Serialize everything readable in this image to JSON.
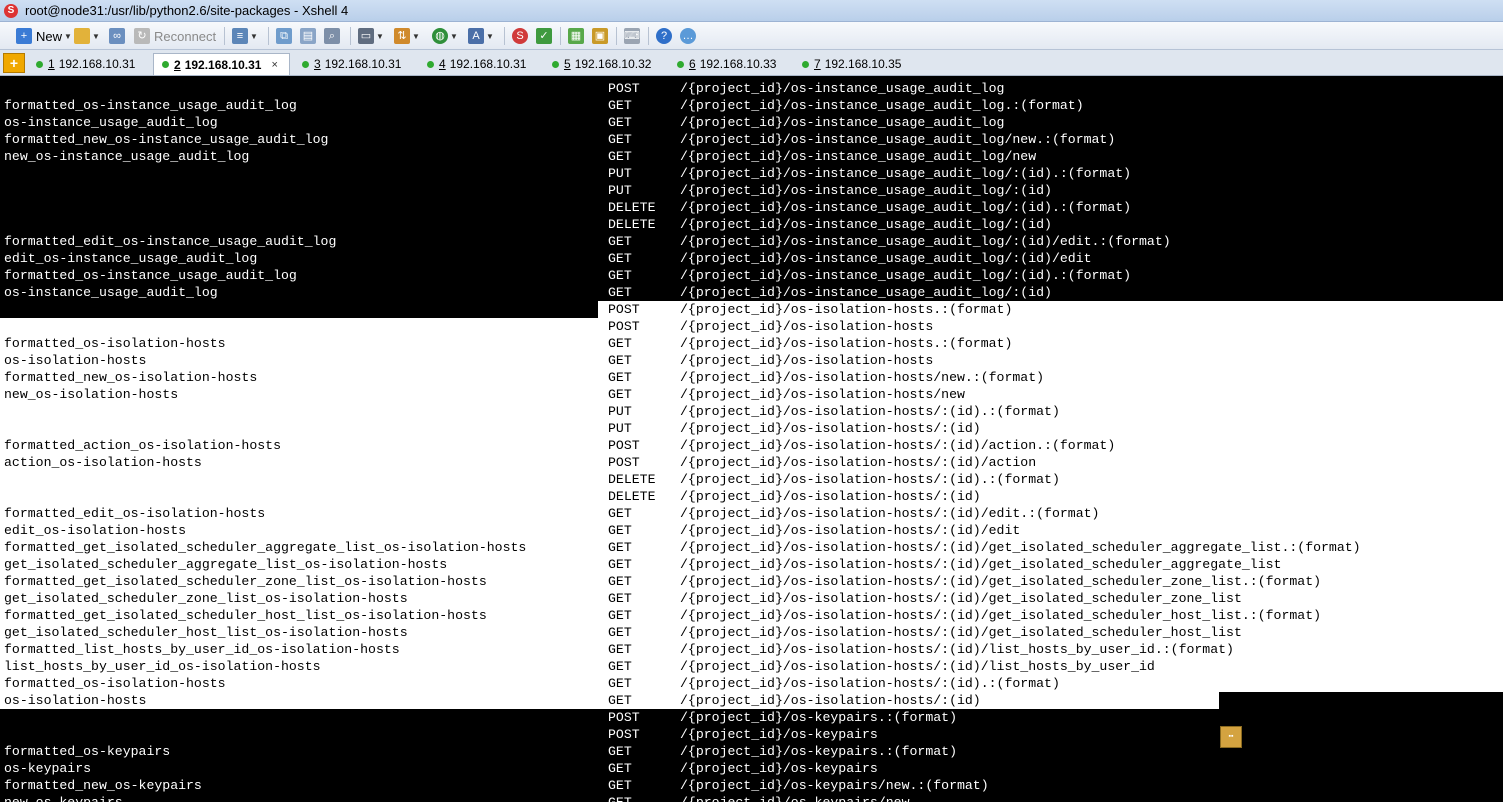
{
  "window": {
    "title": "root@node31:/usr/lib/python2.6/site-packages - Xshell 4"
  },
  "toolbar": {
    "new_label": "New",
    "reconnect_label": "Reconnect"
  },
  "tabs": [
    {
      "index": "1",
      "host": "192.168.10.31",
      "active": false
    },
    {
      "index": "2",
      "host": "192.168.10.31",
      "active": true
    },
    {
      "index": "3",
      "host": "192.168.10.31",
      "active": false
    },
    {
      "index": "4",
      "host": "192.168.10.31",
      "active": false
    },
    {
      "index": "5",
      "host": "192.168.10.32",
      "active": false
    },
    {
      "index": "6",
      "host": "192.168.10.33",
      "active": false
    },
    {
      "index": "7",
      "host": "192.168.10.35",
      "active": false
    }
  ],
  "tab_close_glyph": "×",
  "colors": {
    "terminal_bg": "#000000",
    "terminal_fg": "#ffffff",
    "selection_bg": "#ffffff",
    "selection_fg": "#000000",
    "connected_dot": "#2faa2f"
  },
  "terminal": {
    "lines": [
      {
        "name": "",
        "method": "POST",
        "path": "/{project_id}/os-instance_usage_audit_log"
      },
      {
        "name": "formatted_os-instance_usage_audit_log",
        "method": "GET",
        "path": "/{project_id}/os-instance_usage_audit_log.:(format)"
      },
      {
        "name": "os-instance_usage_audit_log",
        "method": "GET",
        "path": "/{project_id}/os-instance_usage_audit_log"
      },
      {
        "name": "formatted_new_os-instance_usage_audit_log",
        "method": "GET",
        "path": "/{project_id}/os-instance_usage_audit_log/new.:(format)"
      },
      {
        "name": "new_os-instance_usage_audit_log",
        "method": "GET",
        "path": "/{project_id}/os-instance_usage_audit_log/new"
      },
      {
        "name": "",
        "method": "PUT",
        "path": "/{project_id}/os-instance_usage_audit_log/:(id).:(format)"
      },
      {
        "name": "",
        "method": "PUT",
        "path": "/{project_id}/os-instance_usage_audit_log/:(id)"
      },
      {
        "name": "",
        "method": "DELETE",
        "path": "/{project_id}/os-instance_usage_audit_log/:(id).:(format)"
      },
      {
        "name": "",
        "method": "DELETE",
        "path": "/{project_id}/os-instance_usage_audit_log/:(id)"
      },
      {
        "name": "formatted_edit_os-instance_usage_audit_log",
        "method": "GET",
        "path": "/{project_id}/os-instance_usage_audit_log/:(id)/edit.:(format)"
      },
      {
        "name": "edit_os-instance_usage_audit_log",
        "method": "GET",
        "path": "/{project_id}/os-instance_usage_audit_log/:(id)/edit"
      },
      {
        "name": "formatted_os-instance_usage_audit_log",
        "method": "GET",
        "path": "/{project_id}/os-instance_usage_audit_log/:(id).:(format)"
      },
      {
        "name": "os-instance_usage_audit_log",
        "method": "GET",
        "path": "/{project_id}/os-instance_usage_audit_log/:(id)"
      },
      {
        "name": "",
        "method": "POST",
        "path": "/{project_id}/os-isolation-hosts.:(format)"
      },
      {
        "name": "",
        "method": "POST",
        "path": "/{project_id}/os-isolation-hosts"
      },
      {
        "name": "formatted_os-isolation-hosts",
        "method": "GET",
        "path": "/{project_id}/os-isolation-hosts.:(format)"
      },
      {
        "name": "os-isolation-hosts",
        "method": "GET",
        "path": "/{project_id}/os-isolation-hosts"
      },
      {
        "name": "formatted_new_os-isolation-hosts",
        "method": "GET",
        "path": "/{project_id}/os-isolation-hosts/new.:(format)"
      },
      {
        "name": "new_os-isolation-hosts",
        "method": "GET",
        "path": "/{project_id}/os-isolation-hosts/new"
      },
      {
        "name": "",
        "method": "PUT",
        "path": "/{project_id}/os-isolation-hosts/:(id).:(format)"
      },
      {
        "name": "",
        "method": "PUT",
        "path": "/{project_id}/os-isolation-hosts/:(id)"
      },
      {
        "name": "formatted_action_os-isolation-hosts",
        "method": "POST",
        "path": "/{project_id}/os-isolation-hosts/:(id)/action.:(format)"
      },
      {
        "name": "action_os-isolation-hosts",
        "method": "POST",
        "path": "/{project_id}/os-isolation-hosts/:(id)/action"
      },
      {
        "name": "",
        "method": "DELETE",
        "path": "/{project_id}/os-isolation-hosts/:(id).:(format)"
      },
      {
        "name": "",
        "method": "DELETE",
        "path": "/{project_id}/os-isolation-hosts/:(id)"
      },
      {
        "name": "formatted_edit_os-isolation-hosts",
        "method": "GET",
        "path": "/{project_id}/os-isolation-hosts/:(id)/edit.:(format)"
      },
      {
        "name": "edit_os-isolation-hosts",
        "method": "GET",
        "path": "/{project_id}/os-isolation-hosts/:(id)/edit"
      },
      {
        "name": "formatted_get_isolated_scheduler_aggregate_list_os-isolation-hosts",
        "method": "GET",
        "path": "/{project_id}/os-isolation-hosts/:(id)/get_isolated_scheduler_aggregate_list.:(format)"
      },
      {
        "name": "get_isolated_scheduler_aggregate_list_os-isolation-hosts",
        "method": "GET",
        "path": "/{project_id}/os-isolation-hosts/:(id)/get_isolated_scheduler_aggregate_list"
      },
      {
        "name": "formatted_get_isolated_scheduler_zone_list_os-isolation-hosts",
        "method": "GET",
        "path": "/{project_id}/os-isolation-hosts/:(id)/get_isolated_scheduler_zone_list.:(format)"
      },
      {
        "name": "get_isolated_scheduler_zone_list_os-isolation-hosts",
        "method": "GET",
        "path": "/{project_id}/os-isolation-hosts/:(id)/get_isolated_scheduler_zone_list"
      },
      {
        "name": "formatted_get_isolated_scheduler_host_list_os-isolation-hosts",
        "method": "GET",
        "path": "/{project_id}/os-isolation-hosts/:(id)/get_isolated_scheduler_host_list.:(format)"
      },
      {
        "name": "get_isolated_scheduler_host_list_os-isolation-hosts",
        "method": "GET",
        "path": "/{project_id}/os-isolation-hosts/:(id)/get_isolated_scheduler_host_list"
      },
      {
        "name": "formatted_list_hosts_by_user_id_os-isolation-hosts",
        "method": "GET",
        "path": "/{project_id}/os-isolation-hosts/:(id)/list_hosts_by_user_id.:(format)"
      },
      {
        "name": "list_hosts_by_user_id_os-isolation-hosts",
        "method": "GET",
        "path": "/{project_id}/os-isolation-hosts/:(id)/list_hosts_by_user_id"
      },
      {
        "name": "formatted_os-isolation-hosts",
        "method": "GET",
        "path": "/{project_id}/os-isolation-hosts/:(id).:(format)"
      },
      {
        "name": "os-isolation-hosts",
        "method": "GET",
        "path": "/{project_id}/os-isolation-hosts/:(id)"
      },
      {
        "name": "",
        "method": "POST",
        "path": "/{project_id}/os-keypairs.:(format)"
      },
      {
        "name": "",
        "method": "POST",
        "path": "/{project_id}/os-keypairs"
      },
      {
        "name": "formatted_os-keypairs",
        "method": "GET",
        "path": "/{project_id}/os-keypairs.:(format)"
      },
      {
        "name": "os-keypairs",
        "method": "GET",
        "path": "/{project_id}/os-keypairs"
      },
      {
        "name": "formatted_new_os-keypairs",
        "method": "GET",
        "path": "/{project_id}/os-keypairs/new.:(format)"
      },
      {
        "name": "new_os-keypairs",
        "method": "GET",
        "path": "/{project_id}/os-keypairs/new"
      }
    ]
  }
}
